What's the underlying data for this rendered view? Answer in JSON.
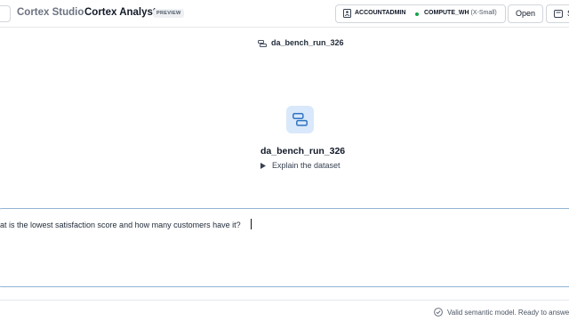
{
  "header": {
    "app_name": "Cortex Studio",
    "page_title": "Cortex Analyst",
    "badge": "PREVIEW",
    "role": "ACCOUNTADMIN",
    "warehouse": "COMPUTE_WH",
    "warehouse_size": "(X-Small)",
    "open_label": "Open",
    "save_label": "S"
  },
  "semantic_model": {
    "top_label": "da_bench_run_326",
    "name": "da_bench_run_326",
    "explain_label": "Explain the dataset"
  },
  "chat": {
    "input_value": "at is the lowest satisfaction score and how many customers have it?"
  },
  "footer": {
    "status": "Valid semantic model. Ready to answer"
  },
  "colors": {
    "accent": "#2f74c0",
    "tile_bg": "#d9e8fb",
    "status_green": "#16a34a"
  },
  "icons": [
    "back-icon",
    "role-icon",
    "warehouse-status-icon",
    "save-icon",
    "semantic-model-icon",
    "caret-right-icon",
    "check-circle-icon"
  ]
}
